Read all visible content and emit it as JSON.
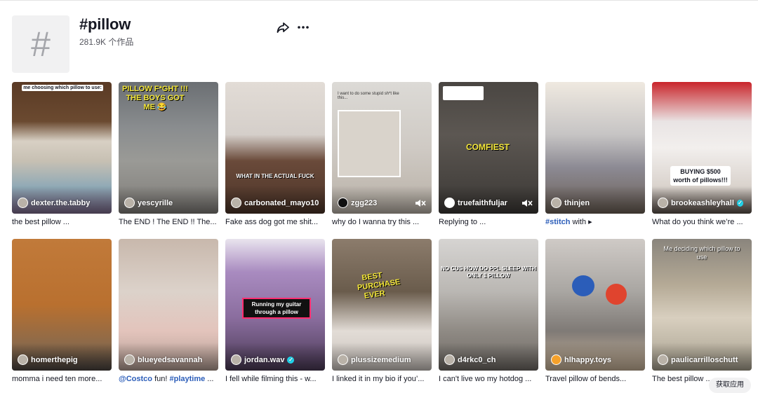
{
  "header": {
    "tag_symbol": "#",
    "title": "#pillow",
    "count": "281.9K 个作品"
  },
  "get_app": "获取应用",
  "row1": [
    {
      "author": "dexter.the.tabby",
      "caption": "the best pillow ...",
      "overlay": "me choosing which pillow to use:"
    },
    {
      "author": "yescyrille",
      "caption": "The END ! The END !! The...",
      "overlay": "PILLOW F*GHT !!! THE BOYS GOT ME 😂"
    },
    {
      "author": "carbonated_mayo10",
      "caption": "Fake ass dog got me shit...",
      "overlay": "WHAT IN THE ACTUAL FUCK"
    },
    {
      "author": "zgg223",
      "caption": "why do I wanna try this ...",
      "overlay": "I want to do some stupid sh*t like this..."
    },
    {
      "author": "truefaithfuljar",
      "caption": "Replying to ...",
      "overlay": "COMFIEST"
    },
    {
      "author": "thinjen",
      "caption_hl": "#stitch",
      "caption_rest": " with ▸"
    },
    {
      "author": "brookeashleyhall",
      "caption": "What do you think we’re ...",
      "overlay": "BUYING $500 worth of pillows!!!"
    }
  ],
  "row2": [
    {
      "author": "homerthepig",
      "caption": "momma i need ten more..."
    },
    {
      "author": "blueyedsavannah",
      "caption_hl": "@Costco",
      "caption_mid": " fun! ",
      "caption_hl2": "#playtime",
      "caption_rest": " ..."
    },
    {
      "author": "jordan.wav",
      "caption": "I fell while filming this - w...",
      "overlay": "Running my guitar through a pillow"
    },
    {
      "author": "plussizemedium",
      "caption": "I linked it in my bio if you’...",
      "overlay": "BEST PURCHASE EVER"
    },
    {
      "author": "d4rkc0_ch",
      "caption": "I can't live wo my hotdog ...",
      "overlay": "NO CUS HOW DO PPL SLEEP WITH ONLY 1 PILLOW"
    },
    {
      "author": "hlhappy.toys",
      "caption": "Travel pillow of bends..."
    },
    {
      "author": "paulicarrilloschutt",
      "caption": "The best pillow ...",
      "overlay": "Me deciding which pillow to use"
    }
  ],
  "colors": {
    "accent": "#2b5db9",
    "verified": "#20d5ec"
  }
}
